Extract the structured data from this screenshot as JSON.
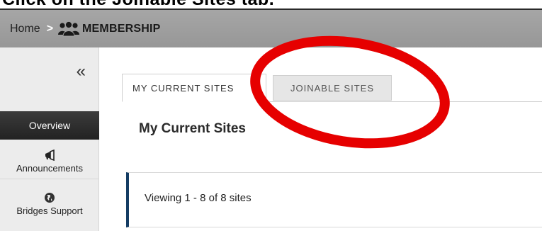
{
  "caption": {
    "text": "Click on the Joinable Sites tab."
  },
  "header": {
    "home_label": "Home",
    "separator": ">",
    "icon": "group-icon",
    "title": "MEMBERSHIP"
  },
  "sidebar": {
    "collapse_label": "«",
    "overview_label": "Overview",
    "items": [
      {
        "label": "Announcements",
        "icon": "megaphone-icon"
      },
      {
        "label": "Bridges Support",
        "icon": "globe-icon"
      }
    ]
  },
  "tabs": [
    {
      "label": "MY CURRENT SITES",
      "active": true
    },
    {
      "label": "JOINABLE SITES",
      "active": false
    }
  ],
  "main": {
    "page_title": "My Current Sites",
    "viewing_text": "Viewing 1 - 8 of 8 sites"
  },
  "colors": {
    "annotation": "#e60000",
    "header_bg": "#a0a0a0",
    "overview_bg": "#2e2e2e",
    "viewing_accent": "#143c63"
  }
}
